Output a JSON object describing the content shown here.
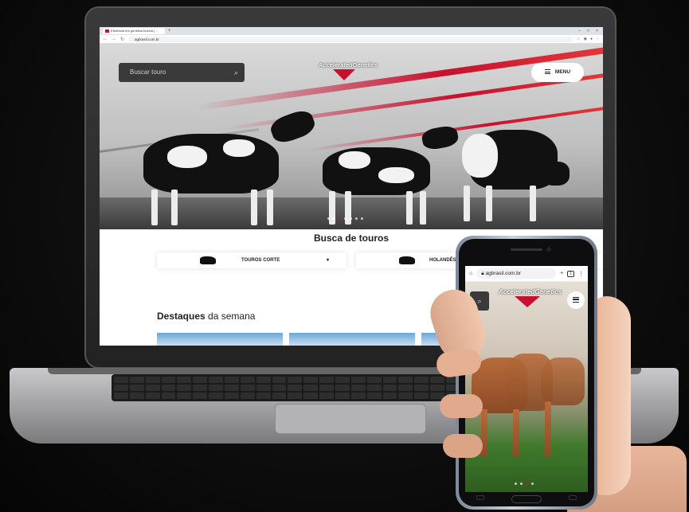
{
  "browser": {
    "tab_title": "Eficiência em genética bovina | ...",
    "tab_close": "×",
    "new_tab": "+",
    "url": "agbrasil.com.br",
    "win_min": "–",
    "win_max": "□",
    "win_close": "×"
  },
  "hero": {
    "search_placeholder": "Buscar touro",
    "logo_text": "AcceleratedGenetics",
    "menu_label": "MENU",
    "slides": 7,
    "active_slide": 3
  },
  "busca": {
    "title": "Busca de touros",
    "options": [
      {
        "label": "TOUROS CORTE",
        "caret": "▾"
      },
      {
        "label": "HOLANDÊS",
        "caret": ""
      }
    ]
  },
  "destaques": {
    "bold": "Destaques",
    "rest": " da semana"
  },
  "mobile": {
    "url": "agbrasil.com.br",
    "logo_text": "AcceleratedGenetics",
    "add_tab": "+",
    "tab_count": "1",
    "more": "⋮"
  },
  "colors": {
    "brand_red": "#c8102e",
    "dark_panel": "#3a3a3a"
  },
  "icons": {
    "search": "search-icon",
    "menu": "hamburger-icon",
    "home": "home-icon",
    "lock": "lock-icon"
  }
}
